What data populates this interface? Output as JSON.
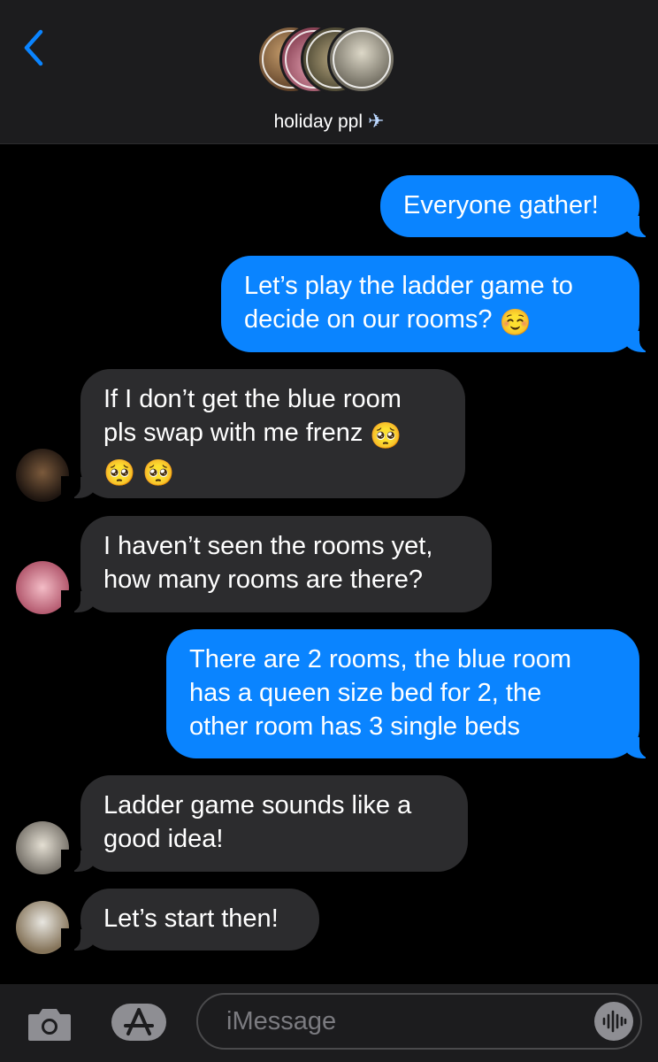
{
  "header": {
    "title": "holiday ppl",
    "title_icon": "airplane-emoji",
    "accent": "#0a84ff"
  },
  "messages": [
    {
      "from": "me",
      "text": "Everyone gather!"
    },
    {
      "from": "me",
      "text": "Let’s play the ladder game to\ndecide on our rooms?",
      "emoji": "☺️"
    },
    {
      "from": "friend-1",
      "text": "If I don’t get the blue room\npls swap with me frenz",
      "emoji": "🥺",
      "line3": "🥺 🥺"
    },
    {
      "from": "friend-2",
      "text": "I haven’t seen the rooms yet,\nhow many rooms are there?"
    },
    {
      "from": "me",
      "text": "There are 2 rooms, the blue room\nhas a queen size bed for 2, the\nother room has 3 single beds"
    },
    {
      "from": "friend-3",
      "text": "Ladder game sounds like a\ngood idea!"
    },
    {
      "from": "friend-4",
      "text": "Let’s start then!"
    }
  ],
  "composer": {
    "placeholder": "iMessage"
  },
  "colors": {
    "sent_bubble": "#0a84ff",
    "received_bubble": "#2c2c2e",
    "background": "#000000",
    "bar": "#1c1c1e"
  }
}
